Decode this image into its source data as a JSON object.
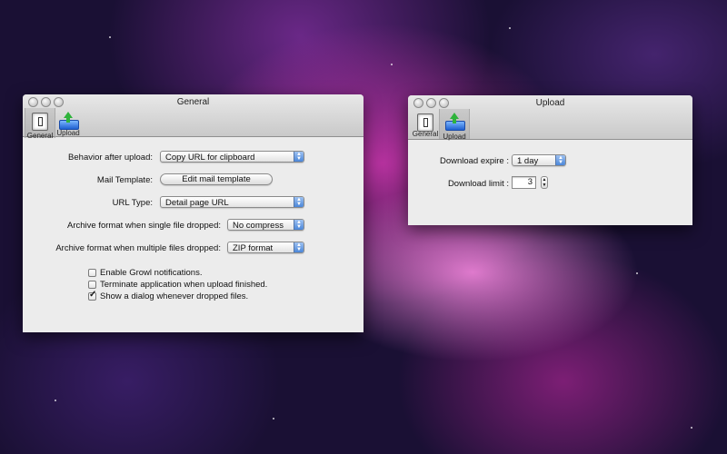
{
  "general_window": {
    "title": "General",
    "toolbar": [
      {
        "label": "General",
        "icon": "switch-icon",
        "selected": true
      },
      {
        "label": "Upload",
        "icon": "upload-icon",
        "selected": false
      }
    ],
    "behavior_after_upload": {
      "label": "Behavior after upload:",
      "value": "Copy URL for clipboard"
    },
    "mail_template": {
      "label": "Mail Template:",
      "button": "Edit mail template"
    },
    "url_type": {
      "label": "URL Type:",
      "value": "Detail page URL"
    },
    "archive_single": {
      "label": "Archive format when single file dropped:",
      "value": "No compress"
    },
    "archive_multiple": {
      "label": "Archive format when multiple files dropped:",
      "value": "ZIP format"
    },
    "checkboxes": [
      {
        "label": "Enable Growl notifications.",
        "checked": false
      },
      {
        "label": "Terminate application when upload finished.",
        "checked": false
      },
      {
        "label": "Show a dialog whenever dropped files.",
        "checked": true
      }
    ]
  },
  "upload_window": {
    "title": "Upload",
    "toolbar": [
      {
        "label": "General",
        "icon": "switch-icon",
        "selected": false
      },
      {
        "label": "Upload",
        "icon": "upload-icon",
        "selected": true
      }
    ],
    "download_expire": {
      "label": "Download expire :",
      "value": "1 day"
    },
    "download_limit": {
      "label": "Download limit :",
      "value": "3"
    }
  }
}
